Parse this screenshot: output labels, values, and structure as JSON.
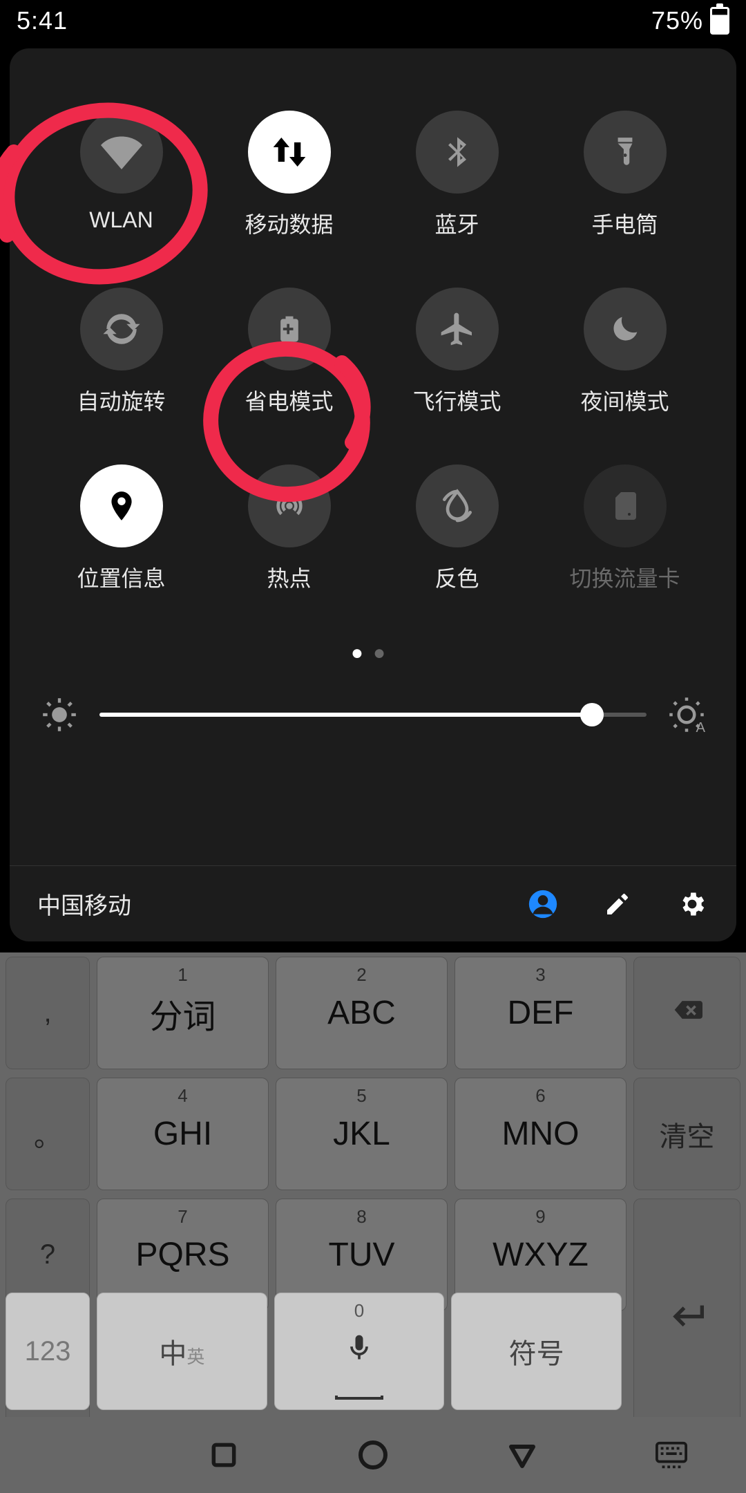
{
  "status": {
    "time": "5:41",
    "battery": "75%"
  },
  "qs": {
    "tiles": [
      {
        "id": "wlan",
        "label": "WLAN",
        "icon": "wifi-icon",
        "state": "off"
      },
      {
        "id": "mobile-data",
        "label": "移动数据",
        "icon": "data-arrows-icon",
        "state": "on"
      },
      {
        "id": "bluetooth",
        "label": "蓝牙",
        "icon": "bluetooth-icon",
        "state": "off"
      },
      {
        "id": "flashlight",
        "label": "手电筒",
        "icon": "flashlight-icon",
        "state": "off"
      },
      {
        "id": "auto-rotate",
        "label": "自动旋转",
        "icon": "rotate-icon",
        "state": "off"
      },
      {
        "id": "battery-saver",
        "label": "省电模式",
        "icon": "battery-plus-icon",
        "state": "off"
      },
      {
        "id": "airplane",
        "label": "飞行模式",
        "icon": "airplane-icon",
        "state": "off"
      },
      {
        "id": "night-mode",
        "label": "夜间模式",
        "icon": "moon-icon",
        "state": "off"
      },
      {
        "id": "location",
        "label": "位置信息",
        "icon": "location-icon",
        "state": "on"
      },
      {
        "id": "hotspot",
        "label": "热点",
        "icon": "hotspot-icon",
        "state": "off"
      },
      {
        "id": "invert",
        "label": "反色",
        "icon": "invert-icon",
        "state": "off"
      },
      {
        "id": "sim-switch",
        "label": "切换流量卡",
        "icon": "sim-icon",
        "state": "disabled"
      }
    ],
    "page_indicator": {
      "current": 1,
      "total": 2
    },
    "brightness_percent": 90
  },
  "footer": {
    "carrier": "中国移动",
    "icons": [
      "user",
      "edit",
      "settings"
    ]
  },
  "annotations": {
    "circled_tiles": [
      "wlan",
      "battery-saver"
    ],
    "color": "#ef2a4b"
  },
  "keyboard": {
    "left_column": [
      ",",
      "。",
      "?",
      "!"
    ],
    "grid": [
      [
        {
          "sup": "1",
          "main": "分词"
        },
        {
          "sup": "2",
          "main": "ABC"
        },
        {
          "sup": "3",
          "main": "DEF"
        }
      ],
      [
        {
          "sup": "4",
          "main": "GHI"
        },
        {
          "sup": "5",
          "main": "JKL"
        },
        {
          "sup": "6",
          "main": "MNO"
        }
      ],
      [
        {
          "sup": "7",
          "main": "PQRS"
        },
        {
          "sup": "8",
          "main": "TUV"
        },
        {
          "sup": "9",
          "main": "WXYZ"
        }
      ]
    ],
    "right_column": {
      "backspace": "⌫",
      "clear": "清空",
      "enter": "↵"
    },
    "bottom": {
      "num": "123",
      "lang_main": "中",
      "lang_sub": "英",
      "voice_sup": "0",
      "symbols": "符号"
    }
  },
  "nav": {
    "recent": "▢",
    "home": "◯",
    "back": "▽",
    "ime": "⌨"
  }
}
